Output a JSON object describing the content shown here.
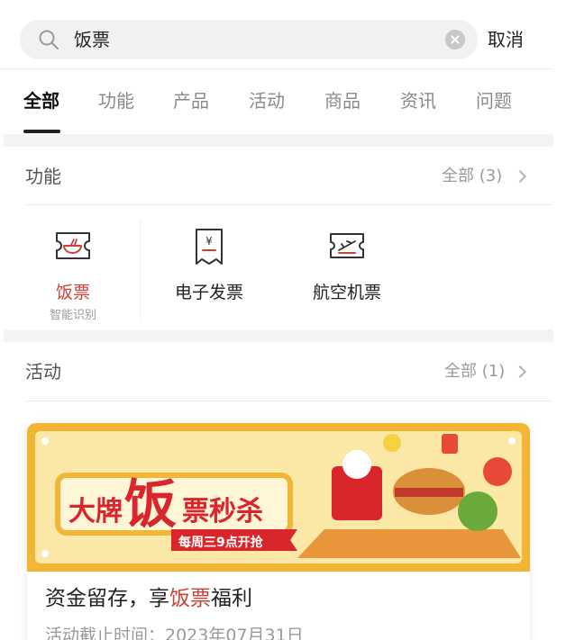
{
  "search": {
    "query": "饭票",
    "cancel_label": "取消"
  },
  "tabs": [
    {
      "label": "全部",
      "active": true
    },
    {
      "label": "功能",
      "active": false
    },
    {
      "label": "产品",
      "active": false
    },
    {
      "label": "活动",
      "active": false
    },
    {
      "label": "商品",
      "active": false
    },
    {
      "label": "资讯",
      "active": false
    },
    {
      "label": "问题",
      "active": false
    }
  ],
  "features_section": {
    "title": "功能",
    "more_label": "全部 (3)",
    "items": [
      {
        "label": "饭票",
        "sublabel": "智能识别",
        "icon": "meal-ticket-icon"
      },
      {
        "label": "电子发票",
        "icon": "e-invoice-icon"
      },
      {
        "label": "航空机票",
        "icon": "air-ticket-icon"
      }
    ]
  },
  "activities_section": {
    "title": "活动",
    "more_label": "全部 (1)",
    "card": {
      "banner_headline_1": "大牌",
      "banner_headline_big": "饭",
      "banner_headline_2": "票秒杀",
      "banner_ribbon": "每周三9点开抢",
      "title_prefix": "资金留存，享",
      "title_highlight": "饭票",
      "title_suffix": "福利",
      "deadline": "活动截止时间：2023年07月31日"
    }
  },
  "colors": {
    "accent_red": "#c8443a",
    "banner_gold": "#f2b534",
    "banner_red": "#d8262c",
    "text_muted": "#9a9a9a"
  }
}
